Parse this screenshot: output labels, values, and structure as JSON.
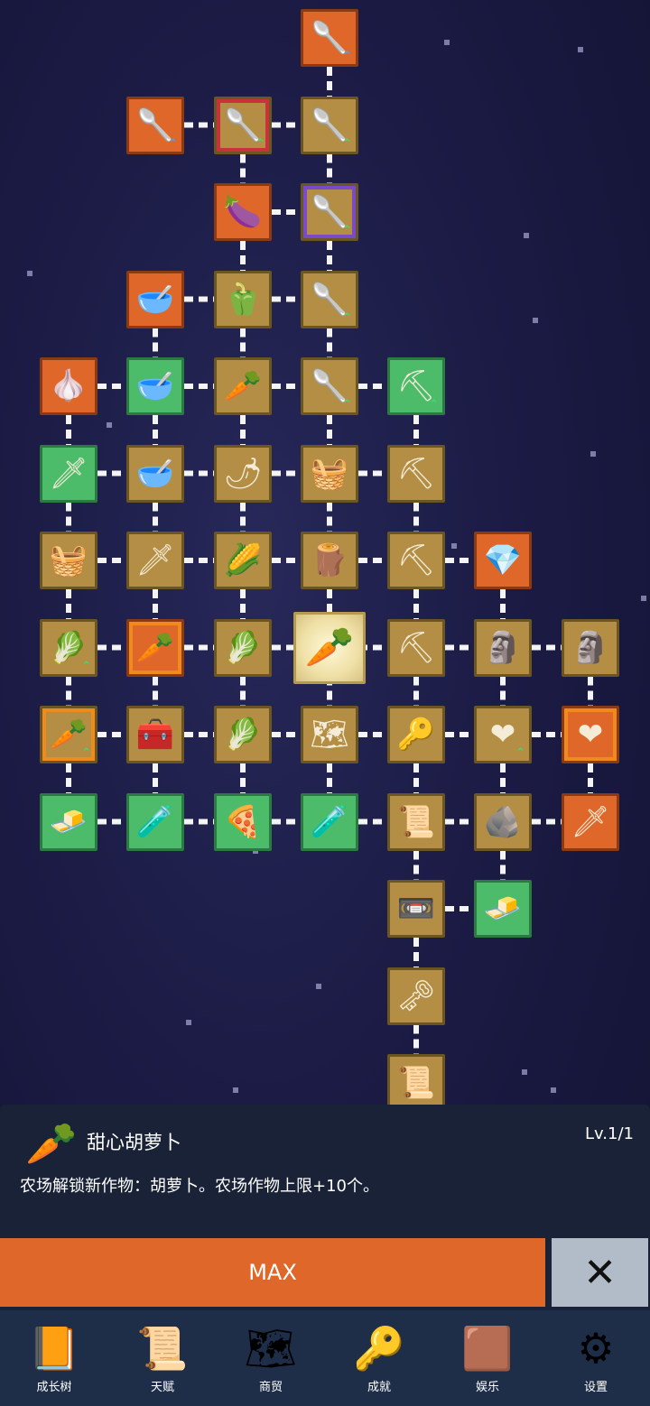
{
  "tree_nodes": [
    {
      "icon": "🥄",
      "col": 3,
      "row": 0,
      "style": "orange",
      "up": "blue"
    },
    {
      "icon": "🥄",
      "col": 1,
      "row": 1,
      "style": "orange",
      "up": "blue"
    },
    {
      "icon": "🥄",
      "col": 2,
      "row": 1,
      "style": "tan sel-red",
      "up": "green"
    },
    {
      "icon": "🥄",
      "col": 3,
      "row": 1,
      "style": "tan",
      "up": "green"
    },
    {
      "icon": "🍆",
      "col": 2,
      "row": 2,
      "style": "orange",
      "up": ""
    },
    {
      "icon": "🥄",
      "col": 3,
      "row": 2,
      "style": "tan sel-purple",
      "up": "green"
    },
    {
      "icon": "🥣",
      "col": 1,
      "row": 3,
      "style": "orange",
      "up": ""
    },
    {
      "icon": "🫑",
      "col": 2,
      "row": 3,
      "style": "tan",
      "up": ""
    },
    {
      "icon": "🥄",
      "col": 3,
      "row": 3,
      "style": "tan",
      "up": "green"
    },
    {
      "icon": "🧄",
      "col": 0,
      "row": 4,
      "style": "orange",
      "up": ""
    },
    {
      "icon": "🥣",
      "col": 1,
      "row": 4,
      "style": "green",
      "up": ""
    },
    {
      "icon": "🥕",
      "col": 2,
      "row": 4,
      "style": "tan",
      "up": ""
    },
    {
      "icon": "🥄",
      "col": 3,
      "row": 4,
      "style": "tan",
      "up": "green"
    },
    {
      "icon": "⛏",
      "col": 4,
      "row": 4,
      "style": "green",
      "up": "green"
    },
    {
      "icon": "🗡",
      "col": 0,
      "row": 5,
      "style": "green",
      "up": ""
    },
    {
      "icon": "🥣",
      "col": 1,
      "row": 5,
      "style": "tan",
      "up": ""
    },
    {
      "icon": "🌶",
      "col": 2,
      "row": 5,
      "style": "tan",
      "up": ""
    },
    {
      "icon": "🧺",
      "col": 3,
      "row": 5,
      "style": "tan",
      "up": ""
    },
    {
      "icon": "⛏",
      "col": 4,
      "row": 5,
      "style": "tan",
      "up": ""
    },
    {
      "icon": "🧺",
      "col": 0,
      "row": 6,
      "style": "tan",
      "up": ""
    },
    {
      "icon": "🗡",
      "col": 1,
      "row": 6,
      "style": "tan",
      "up": ""
    },
    {
      "icon": "🌽",
      "col": 2,
      "row": 6,
      "style": "tan",
      "up": ""
    },
    {
      "icon": "🪵",
      "col": 3,
      "row": 6,
      "style": "tan",
      "up": ""
    },
    {
      "icon": "⛏",
      "col": 4,
      "row": 6,
      "style": "tan",
      "up": ""
    },
    {
      "icon": "💎",
      "col": 5,
      "row": 6,
      "style": "orange",
      "up": ""
    },
    {
      "icon": "🥬",
      "col": 0,
      "row": 7,
      "style": "tan",
      "up": "green"
    },
    {
      "icon": "🥕",
      "col": 1,
      "row": 7,
      "style": "orange sel-orange",
      "up": ""
    },
    {
      "icon": "🥬",
      "col": 2,
      "row": 7,
      "style": "tan",
      "up": ""
    },
    {
      "icon": "🥕",
      "col": 3,
      "row": 7,
      "style": "selected",
      "up": ""
    },
    {
      "icon": "⛏",
      "col": 4,
      "row": 7,
      "style": "tan",
      "up": ""
    },
    {
      "icon": "🗿",
      "col": 5,
      "row": 7,
      "style": "tan",
      "up": ""
    },
    {
      "icon": "🗿",
      "col": 6,
      "row": 7,
      "style": "tan",
      "up": ""
    },
    {
      "icon": "🥕",
      "col": 0,
      "row": 8,
      "style": "tan sel-orange",
      "up": "green"
    },
    {
      "icon": "🧰",
      "col": 1,
      "row": 8,
      "style": "tan",
      "up": ""
    },
    {
      "icon": "🥬",
      "col": 2,
      "row": 8,
      "style": "tan",
      "up": ""
    },
    {
      "icon": "🗺",
      "col": 3,
      "row": 8,
      "style": "tan",
      "up": ""
    },
    {
      "icon": "🔑",
      "col": 4,
      "row": 8,
      "style": "tan",
      "up": ""
    },
    {
      "icon": "❤",
      "col": 5,
      "row": 8,
      "style": "tan",
      "up": "green"
    },
    {
      "icon": "❤",
      "col": 6,
      "row": 8,
      "style": "orange sel-orange",
      "up": ""
    },
    {
      "icon": "🧈",
      "col": 0,
      "row": 9,
      "style": "green",
      "up": ""
    },
    {
      "icon": "🧪",
      "col": 1,
      "row": 9,
      "style": "green",
      "up": ""
    },
    {
      "icon": "🍕",
      "col": 2,
      "row": 9,
      "style": "green",
      "up": ""
    },
    {
      "icon": "🧪",
      "col": 3,
      "row": 9,
      "style": "green",
      "up": ""
    },
    {
      "icon": "📜",
      "col": 4,
      "row": 9,
      "style": "tan",
      "up": ""
    },
    {
      "icon": "🪨",
      "col": 5,
      "row": 9,
      "style": "tan",
      "up": ""
    },
    {
      "icon": "🗡",
      "col": 6,
      "row": 9,
      "style": "orange",
      "up": ""
    },
    {
      "icon": "📼",
      "col": 4,
      "row": 10,
      "style": "tan",
      "up": ""
    },
    {
      "icon": "🧈",
      "col": 5,
      "row": 10,
      "style": "green",
      "up": ""
    },
    {
      "icon": "🗝",
      "col": 4,
      "row": 11,
      "style": "tan",
      "up": ""
    },
    {
      "icon": "📜",
      "col": 4,
      "row": 12,
      "style": "tan",
      "up": ""
    },
    {
      "icon": "🪨",
      "col": 4,
      "row": 13,
      "style": "dim",
      "up": ""
    }
  ],
  "panel": {
    "icon": "🥕",
    "title": "甜心胡萝卜",
    "level": "Lv.1/1",
    "description": "农场解锁新作物：胡萝卜。农场作物上限+10个。"
  },
  "actions": {
    "max_label": "MAX",
    "close_icon": "✕"
  },
  "nav": [
    {
      "label": "成长树",
      "icon": "📙"
    },
    {
      "label": "天赋",
      "icon": "📜"
    },
    {
      "label": "商贸",
      "icon": "🗺"
    },
    {
      "label": "成就",
      "icon": "🔑"
    },
    {
      "label": "娱乐",
      "icon": "🟫"
    },
    {
      "label": "设置",
      "icon": "⚙"
    }
  ],
  "colors": {
    "tan": "#b38e44",
    "orange": "#e0672a",
    "green": "#4cbc6a",
    "panel_bg": "#192236",
    "nav_bg": "#1e2e48"
  }
}
